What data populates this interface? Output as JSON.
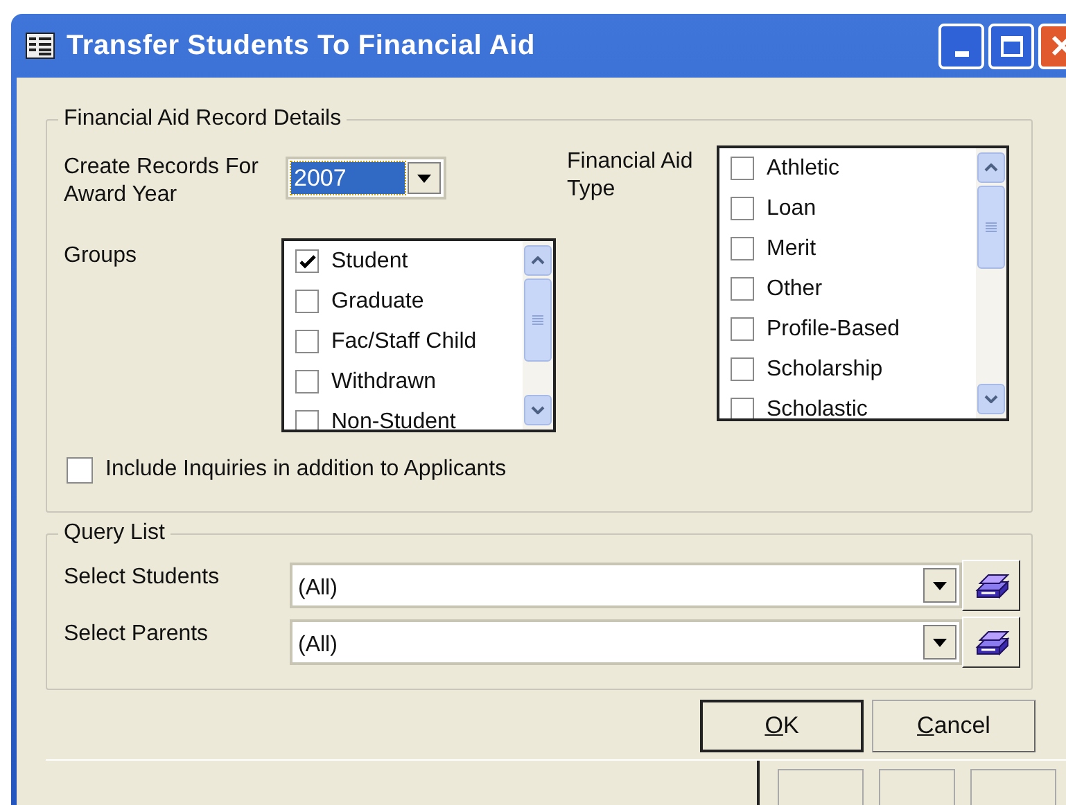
{
  "window": {
    "title": "Transfer Students To Financial Aid"
  },
  "details": {
    "legend": "Financial Aid Record Details",
    "award_year": {
      "label": "Create Records For Award Year",
      "value": "2007"
    },
    "groups": {
      "label": "Groups",
      "items": [
        {
          "label": "Student",
          "checked": true
        },
        {
          "label": "Graduate",
          "checked": false
        },
        {
          "label": "Fac/Staff Child",
          "checked": false
        },
        {
          "label": "Withdrawn",
          "checked": false
        },
        {
          "label": "Non-Student",
          "checked": false
        }
      ]
    },
    "aid_type": {
      "label": "Financial Aid Type",
      "items": [
        {
          "label": "Athletic",
          "checked": false
        },
        {
          "label": "Loan",
          "checked": false
        },
        {
          "label": "Merit",
          "checked": false
        },
        {
          "label": "Other",
          "checked": false
        },
        {
          "label": "Profile-Based",
          "checked": false
        },
        {
          "label": "Scholarship",
          "checked": false
        },
        {
          "label": "Scholastic",
          "checked": false
        }
      ]
    },
    "include_inquiries": {
      "label": "Include Inquiries in addition to Applicants",
      "checked": false
    }
  },
  "query_list": {
    "legend": "Query List",
    "rows": [
      {
        "label": "Select Students",
        "value": "(All)"
      },
      {
        "label": "Select Parents",
        "value": "(All)"
      }
    ]
  },
  "buttons": [
    {
      "label": "OK",
      "default": true
    },
    {
      "label": "Cancel",
      "default": false
    }
  ]
}
